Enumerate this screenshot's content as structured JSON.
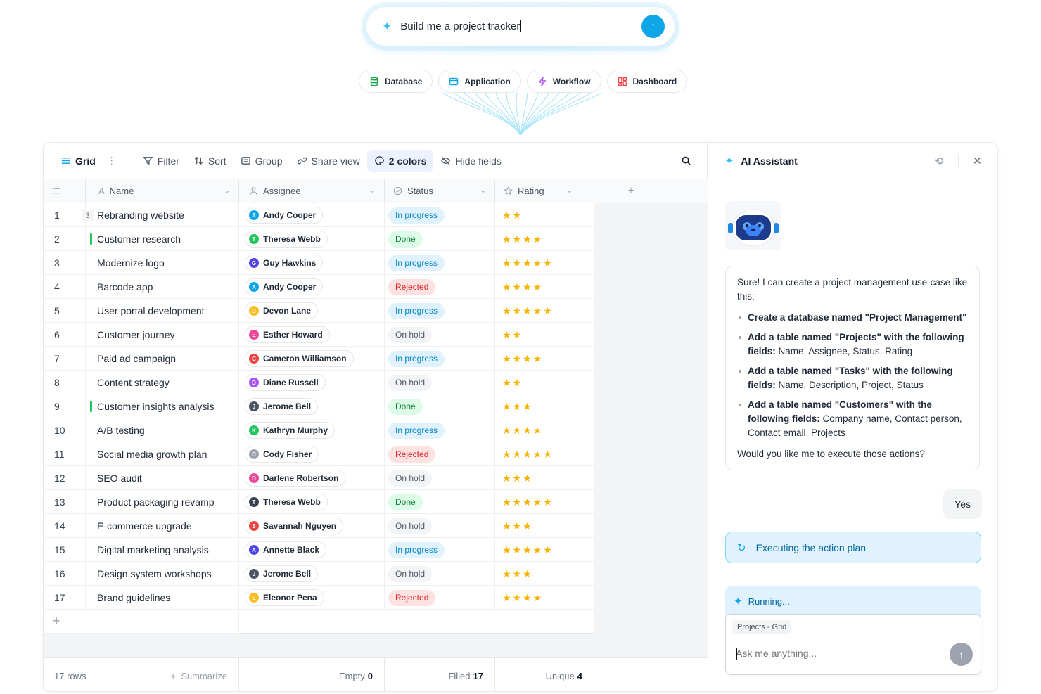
{
  "prompt": {
    "text": "Build me a project tracker",
    "send_icon": "arrow-up-icon"
  },
  "chips": [
    {
      "label": "Database",
      "icon": "database-icon",
      "color": "#16a34a"
    },
    {
      "label": "Application",
      "icon": "window-icon",
      "color": "#0ea5e9"
    },
    {
      "label": "Workflow",
      "icon": "bolt-icon",
      "color": "#a855f7"
    },
    {
      "label": "Dashboard",
      "icon": "dashboard-icon",
      "color": "#ef4444"
    }
  ],
  "toolbar": {
    "view_label": "Grid",
    "filter_label": "Filter",
    "sort_label": "Sort",
    "group_label": "Group",
    "share_label": "Share view",
    "colors_label": "2 colors",
    "hide_label": "Hide fields"
  },
  "columns": {
    "name": "Name",
    "assignee": "Assignee",
    "status": "Status",
    "rating": "Rating",
    "add": "+"
  },
  "rows": [
    {
      "num": "1",
      "name": "Rebranding website",
      "assignee": "Andy Cooper",
      "initial": "A",
      "avatar_color": "#0ea5e9",
      "status": "In progress",
      "status_kind": "progress",
      "rating": 2,
      "count_badge": "3"
    },
    {
      "num": "2",
      "name": "Customer research",
      "assignee": "Theresa Webb",
      "initial": "T",
      "avatar_color": "#22c55e",
      "status": "Done",
      "status_kind": "done",
      "rating": 4,
      "marker": true
    },
    {
      "num": "3",
      "name": "Modernize logo",
      "assignee": "Guy Hawkins",
      "initial": "G",
      "avatar_color": "#4f46e5",
      "status": "In progress",
      "status_kind": "progress",
      "rating": 5
    },
    {
      "num": "4",
      "name": "Barcode app",
      "assignee": "Andy Cooper",
      "initial": "A",
      "avatar_color": "#0ea5e9",
      "status": "Rejected",
      "status_kind": "rejected",
      "rating": 4
    },
    {
      "num": "5",
      "name": "User portal development",
      "assignee": "Devon Lane",
      "initial": "D",
      "avatar_color": "#fbbf24",
      "status": "In progress",
      "status_kind": "progress",
      "rating": 5
    },
    {
      "num": "6",
      "name": "Customer journey",
      "assignee": "Esther Howard",
      "initial": "E",
      "avatar_color": "#ec4899",
      "status": "On hold",
      "status_kind": "hold",
      "rating": 2
    },
    {
      "num": "7",
      "name": "Paid ad campaign",
      "assignee": "Cameron Williamson",
      "initial": "C",
      "avatar_color": "#ef4444",
      "status": "In progress",
      "status_kind": "progress",
      "rating": 4
    },
    {
      "num": "8",
      "name": "Content strategy",
      "assignee": "Diane Russell",
      "initial": "D",
      "avatar_color": "#a855f7",
      "status": "On hold",
      "status_kind": "hold",
      "rating": 2
    },
    {
      "num": "9",
      "name": "Customer insights analysis",
      "assignee": "Jerome Bell",
      "initial": "J",
      "avatar_color": "#4b5563",
      "status": "Done",
      "status_kind": "done",
      "rating": 3,
      "marker": true
    },
    {
      "num": "10",
      "name": "A/B testing",
      "assignee": "Kathryn Murphy",
      "initial": "K",
      "avatar_color": "#22c55e",
      "status": "In progress",
      "status_kind": "progress",
      "rating": 4
    },
    {
      "num": "11",
      "name": "Social media growth plan",
      "assignee": "Cody Fisher",
      "initial": "C",
      "avatar_color": "#9ca3af",
      "status": "Rejected",
      "status_kind": "rejected",
      "rating": 5
    },
    {
      "num": "12",
      "name": "SEO audit",
      "assignee": "Darlene Robertson",
      "initial": "D",
      "avatar_color": "#ec4899",
      "status": "On hold",
      "status_kind": "hold",
      "rating": 3
    },
    {
      "num": "13",
      "name": "Product packaging revamp",
      "assignee": "Theresa Webb",
      "initial": "T",
      "avatar_color": "#374151",
      "status": "Done",
      "status_kind": "done",
      "rating": 5
    },
    {
      "num": "14",
      "name": "E-commerce upgrade",
      "assignee": "Savannah Nguyen",
      "initial": "S",
      "avatar_color": "#ef4444",
      "status": "On hold",
      "status_kind": "hold",
      "rating": 3
    },
    {
      "num": "15",
      "name": "Digital marketing analysis",
      "assignee": "Annette Black",
      "initial": "A",
      "avatar_color": "#4f46e5",
      "status": "In progress",
      "status_kind": "progress",
      "rating": 5
    },
    {
      "num": "16",
      "name": "Design system workshops",
      "assignee": "Jerome Bell",
      "initial": "J",
      "avatar_color": "#4b5563",
      "status": "On hold",
      "status_kind": "hold",
      "rating": 3
    },
    {
      "num": "17",
      "name": "Brand guidelines",
      "assignee": "Eleonor Pena",
      "initial": "E",
      "avatar_color": "#fbbf24",
      "status": "Rejected",
      "status_kind": "rejected",
      "rating": 4
    }
  ],
  "footer": {
    "rows_label": "17 rows",
    "summarize_label": "Summarize",
    "empty_label": "Empty",
    "empty_value": "0",
    "filled_label": "Filled",
    "filled_value": "17",
    "unique_label": "Unique",
    "unique_value": "4"
  },
  "assistant": {
    "title": "AI Assistant",
    "intro": "Sure! I can create a project management use-case like this:",
    "items": [
      {
        "bold": "Create a database named \"Project Management\"",
        "rest": ""
      },
      {
        "bold": "Add a table named \"Projects\" with the following fields:",
        "rest": " Name, Assignee, Status, Rating"
      },
      {
        "bold": "Add a table named \"Tasks\" with the following fields:",
        "rest": " Name, Description, Project, Status"
      },
      {
        "bold": "Add a table named \"Customers\" with the following fields:",
        "rest": " Company name, Contact person, Contact email, Projects"
      }
    ],
    "question": "Would you like me to execute those actions?",
    "user_reply": "Yes",
    "executing": "Executing the action plan",
    "running": "Running...",
    "context_tag": "Projects - Grid",
    "input_placeholder": "Ask me anything..."
  }
}
